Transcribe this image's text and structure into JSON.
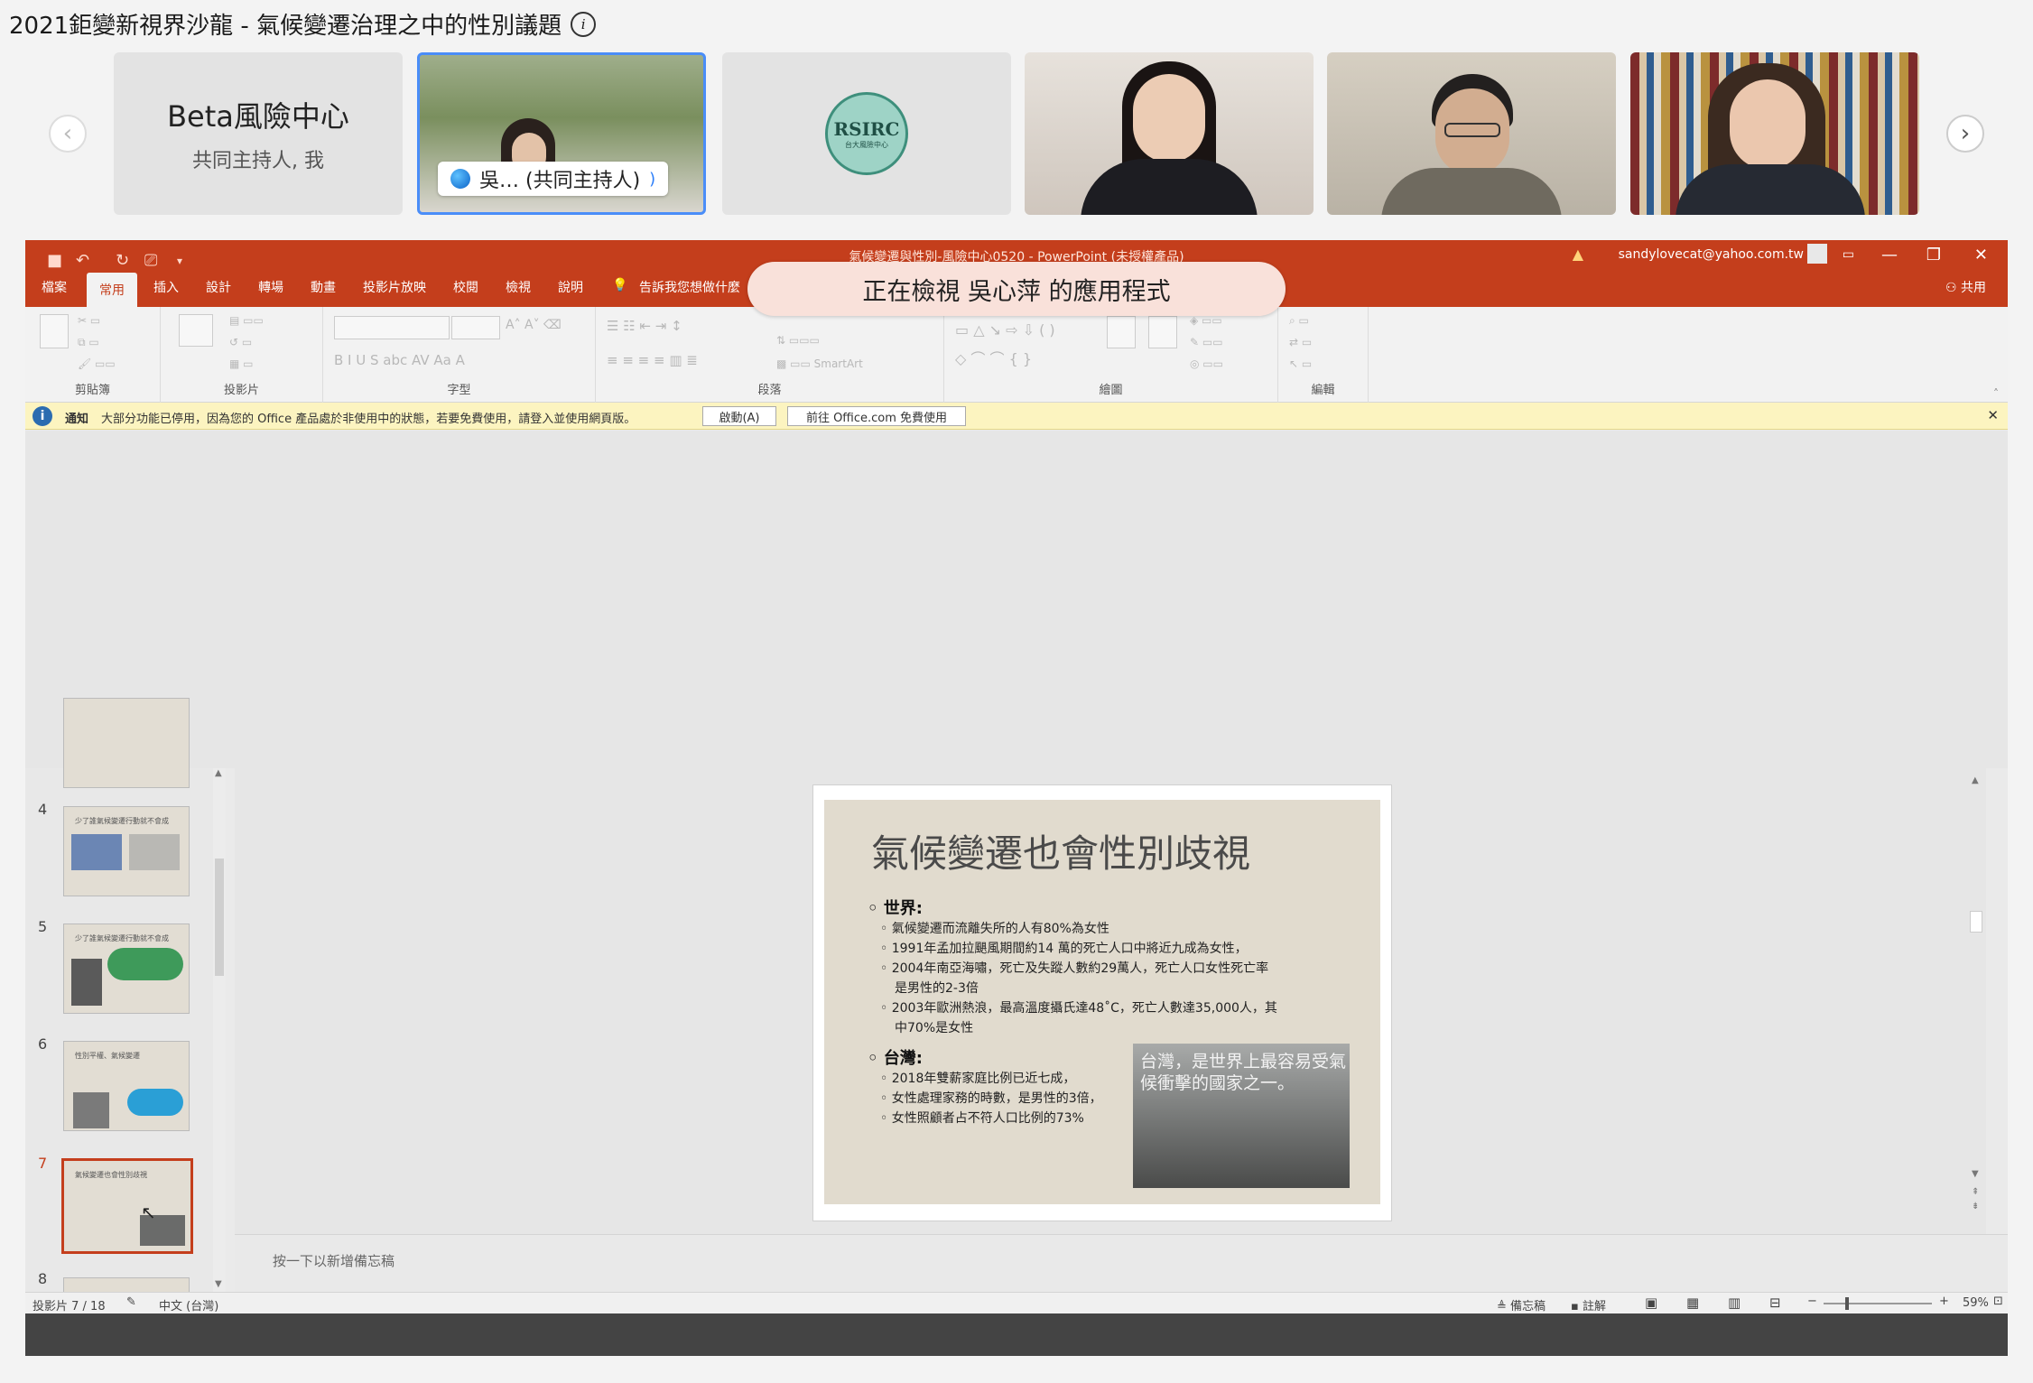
{
  "meeting": {
    "title": "2021鉅變新視界沙龍 - 氣候變遷治理之中的性別議題"
  },
  "participants": {
    "tile1": {
      "name": "Beta風險中心",
      "role": "共同主持人, 我"
    },
    "tile2": {
      "label": "吳… (共同主持人)"
    },
    "tile3": {
      "logo_text": "RSIRC",
      "logo_sub": "台大風險中心"
    }
  },
  "ppt": {
    "doc_title": "氣候變遷與性別-風險中心0520 - PowerPoint (未授權產品)",
    "user_email": "sandylovecat@yahoo.com.tw",
    "tabs": [
      "檔案",
      "常用",
      "插入",
      "設計",
      "轉場",
      "動畫",
      "投影片放映",
      "校閱",
      "檢視",
      "說明"
    ],
    "tell_me": "告訴我您想做什麼",
    "share": "共用",
    "ribbon_groups": [
      "剪貼簿",
      "投影片",
      "字型",
      "段落",
      "繪圖",
      "編輯"
    ],
    "notice": {
      "label": "通知",
      "text": "大部分功能已停用，因為您的 Office 產品處於非使用中的狀態，若要免費使用，請登入並使用網頁版。",
      "activate_button": "啟動(A)",
      "office_button": "前往 Office.com 免費使用"
    },
    "viewing_banner": "正在檢視 吳心萍 的應用程式",
    "thumbnails": [
      {
        "num": "4",
        "title": "少了誰氣候變遷行動就不會成"
      },
      {
        "num": "5",
        "title": "少了誰氣候變遷行動就不會成"
      },
      {
        "num": "6",
        "title": "性別平權、氣候變遷"
      },
      {
        "num": "7",
        "title": "氣候變遷也會性別歧視"
      },
      {
        "num": "8",
        "title": ""
      }
    ],
    "slide": {
      "title": "氣候變遷也會性別歧視",
      "world_heading": "世界:",
      "world_items": [
        "氣候變遷而流離失所的人有80%為女性",
        "1991年孟加拉颶風期間約14 萬的死亡人口中將近九成為女性，",
        "2004年南亞海嘯，死亡及失蹤人數約29萬人，死亡人口女性死亡率",
        "是男性的2-3倍",
        "2003年歐洲熱浪，最高溫度攝氏達48˚C，死亡人數達35,000人，其",
        "中70%是女性"
      ],
      "taiwan_heading": "台灣:",
      "taiwan_items": [
        "2018年雙薪家庭比例已近七成，",
        "女性處理家務的時數，是男性的3倍，",
        "女性照顧者占不符人口比例的73%"
      ],
      "photo_caption": "台灣，是世界上最容易受氣候衝擊的國家之一。"
    },
    "notes_placeholder": "按一下以新增備忘稿",
    "status": {
      "slide_info": "投影片 7 / 18",
      "language": "中文 (台灣)",
      "notes": "備忘稿",
      "comments": "註解",
      "zoom": "59%"
    }
  }
}
